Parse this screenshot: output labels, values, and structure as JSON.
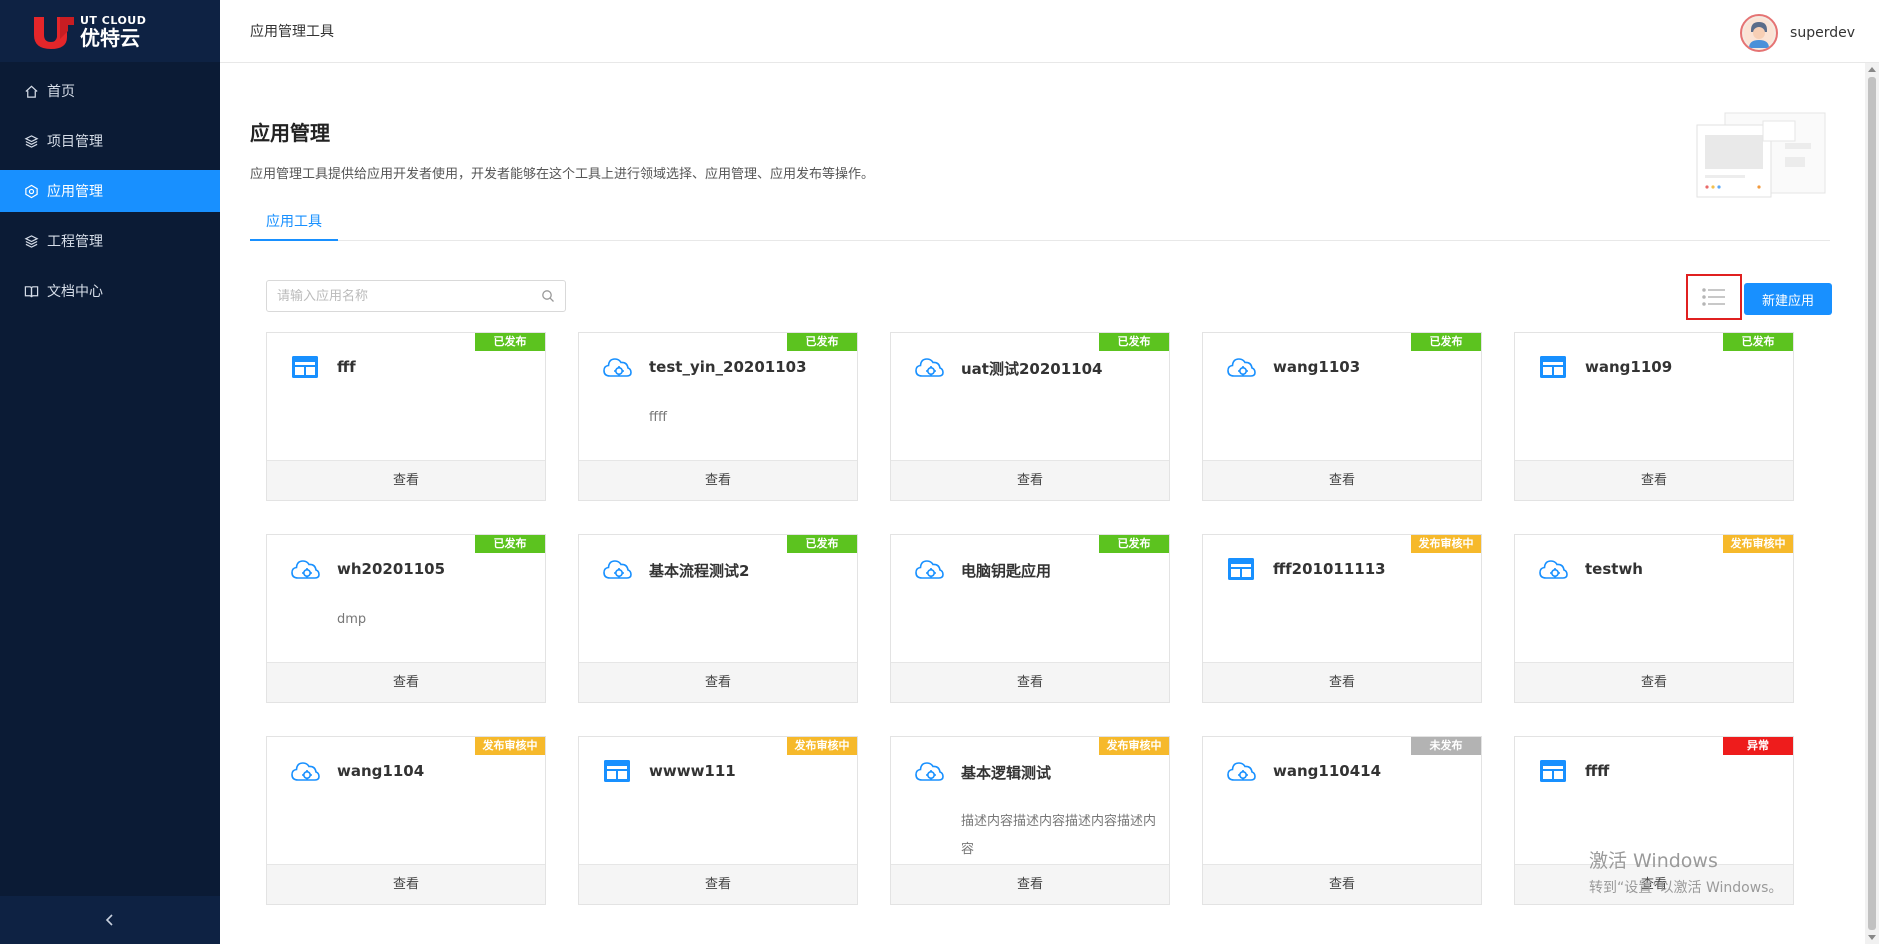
{
  "sidebar": {
    "logo_en": "UT CLOUD",
    "logo_cn": "优特云",
    "items": [
      {
        "label": "首页",
        "icon": "home-icon"
      },
      {
        "label": "项目管理",
        "icon": "layers-icon"
      },
      {
        "label": "应用管理",
        "icon": "app-icon"
      },
      {
        "label": "工程管理",
        "icon": "layers-icon"
      },
      {
        "label": "文档中心",
        "icon": "book-icon"
      }
    ],
    "collapse_icon": "chevron-left-icon"
  },
  "header": {
    "breadcrumb": "应用管理工具",
    "username": "superdev"
  },
  "page": {
    "title": "应用管理",
    "description": "应用管理工具提供给应用开发者使用，开发者能够在这个工具上进行领域选择、应用管理、应用发布等操作。",
    "tab": "应用工具"
  },
  "search": {
    "placeholder": "请输入应用名称",
    "value": ""
  },
  "toolbar": {
    "new_label": "新建应用",
    "view_icon": "list-view-icon"
  },
  "status_colors": {
    "已发布": "#5cc31f",
    "发布审核中": "#f6b92b",
    "未发布": "#b3b3b3",
    "异常": "#ee1c1c"
  },
  "view_label": "查看",
  "cards": [
    {
      "name": "fff",
      "status": "已发布",
      "icon": "window-icon",
      "desc": ""
    },
    {
      "name": "test_yin_20201103",
      "status": "已发布",
      "icon": "cloud-gear-icon",
      "desc": "ffff"
    },
    {
      "name": "uat测试20201104",
      "status": "已发布",
      "icon": "cloud-gear-icon",
      "desc": ""
    },
    {
      "name": "wang1103",
      "status": "已发布",
      "icon": "cloud-gear-icon",
      "desc": ""
    },
    {
      "name": "wang1109",
      "status": "已发布",
      "icon": "window-icon",
      "desc": ""
    },
    {
      "name": "wh20201105",
      "status": "已发布",
      "icon": "cloud-gear-icon",
      "desc": "dmp"
    },
    {
      "name": "基本流程测试2",
      "status": "已发布",
      "icon": "cloud-gear-icon",
      "desc": ""
    },
    {
      "name": "电脑钥匙应用",
      "status": "已发布",
      "icon": "cloud-gear-icon",
      "desc": ""
    },
    {
      "name": "fff201011113",
      "status": "发布审核中",
      "icon": "window-icon",
      "desc": ""
    },
    {
      "name": "testwh",
      "status": "发布审核中",
      "icon": "cloud-gear-icon",
      "desc": ""
    },
    {
      "name": "wang1104",
      "status": "发布审核中",
      "icon": "cloud-gear-icon",
      "desc": ""
    },
    {
      "name": "wwww111",
      "status": "发布审核中",
      "icon": "window-icon",
      "desc": ""
    },
    {
      "name": "基本逻辑测试",
      "status": "发布审核中",
      "icon": "cloud-gear-icon",
      "desc": "描述内容描述内容描述内容描述内容"
    },
    {
      "name": "wang110414",
      "status": "未发布",
      "icon": "cloud-gear-icon",
      "desc": ""
    },
    {
      "name": "ffff",
      "status": "异常",
      "icon": "window-icon",
      "desc": ""
    }
  ],
  "watermark": {
    "line1": "激活 Windows",
    "line2": "转到“设置”以激活 Windows。"
  }
}
